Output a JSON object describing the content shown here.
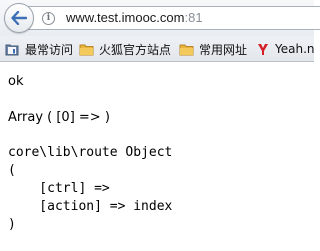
{
  "navbar": {
    "url_host": "www.test.imooc.com",
    "url_port": ":81"
  },
  "bookmarks": [
    {
      "label": "最常访问",
      "icon": "bookmark-folder-icon"
    },
    {
      "label": "火狐官方站点",
      "icon": "folder-icon"
    },
    {
      "label": "常用网址",
      "icon": "folder-icon"
    },
    {
      "label": "Yeah.n",
      "icon": "yeah-logo-icon"
    }
  ],
  "content": {
    "line1": "ok",
    "line2": "Array ( [0] => )",
    "line3": "core\\lib\\route Object",
    "line4": "(",
    "line5": "    [ctrl] =>",
    "line6": "    [action] => index",
    "line7": ")"
  },
  "colors": {
    "back_arrow": "#3d6fb6",
    "folder": "#e8b43a",
    "yeah_logo": "#d41f26"
  }
}
